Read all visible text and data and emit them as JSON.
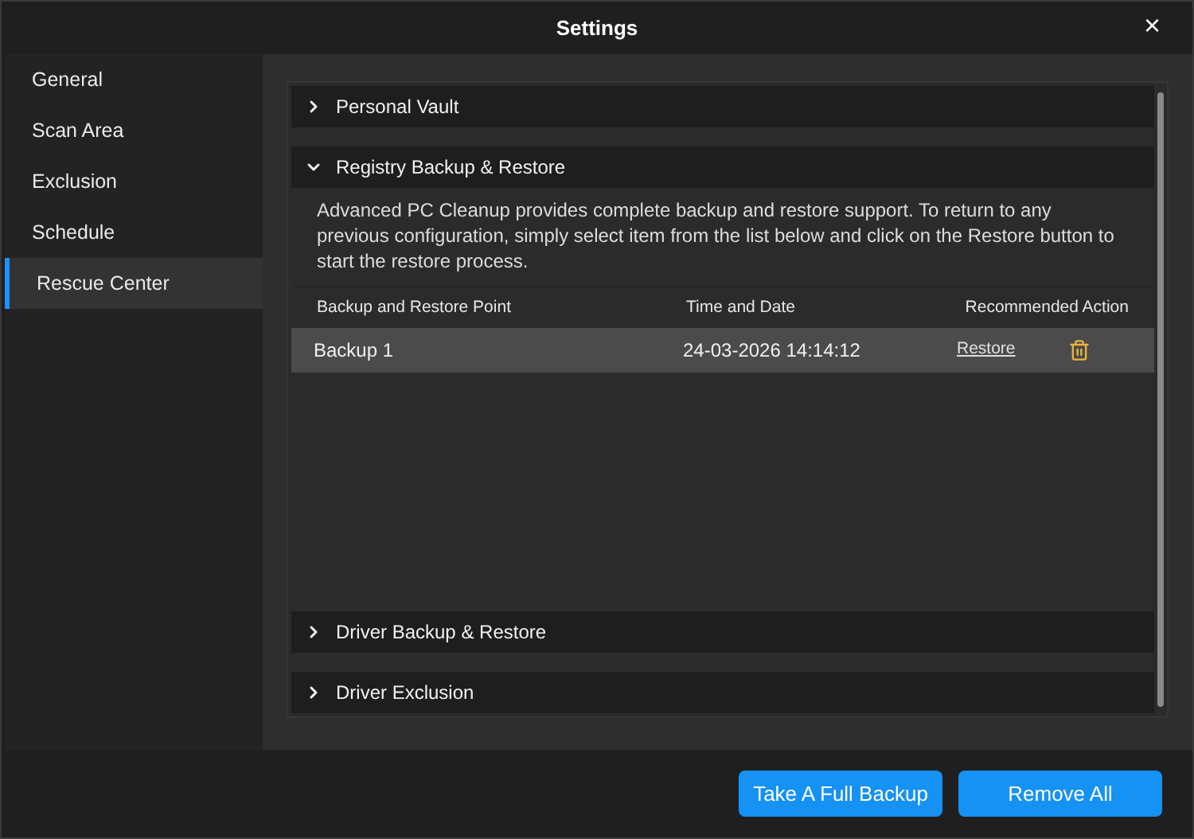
{
  "window": {
    "title": "Settings",
    "close": "×"
  },
  "sidebar": {
    "items": [
      {
        "label": "General",
        "selected": false
      },
      {
        "label": "Scan Area",
        "selected": false
      },
      {
        "label": "Exclusion",
        "selected": false
      },
      {
        "label": "Schedule",
        "selected": false
      },
      {
        "label": "Rescue Center",
        "selected": true
      }
    ]
  },
  "sections": [
    {
      "title": "Personal Vault",
      "expanded": false
    },
    {
      "title": "Registry Backup & Restore",
      "expanded": true,
      "description": "Advanced PC Cleanup provides complete backup and restore support. To return to any previous configuration, simply select item from the list below and click on the Restore button to start the restore process.",
      "columns": [
        "Backup and Restore Point",
        "Time and Date",
        "Recommended Action"
      ],
      "rows": [
        {
          "name": "Backup 1",
          "time": "24-03-2026 14:14:12",
          "action": "Restore",
          "selected": true
        }
      ]
    },
    {
      "title": "Driver Backup & Restore",
      "expanded": false
    },
    {
      "title": "Driver Exclusion",
      "expanded": false
    }
  ],
  "buttons": [
    "Take A Full Backup",
    "Remove All"
  ]
}
